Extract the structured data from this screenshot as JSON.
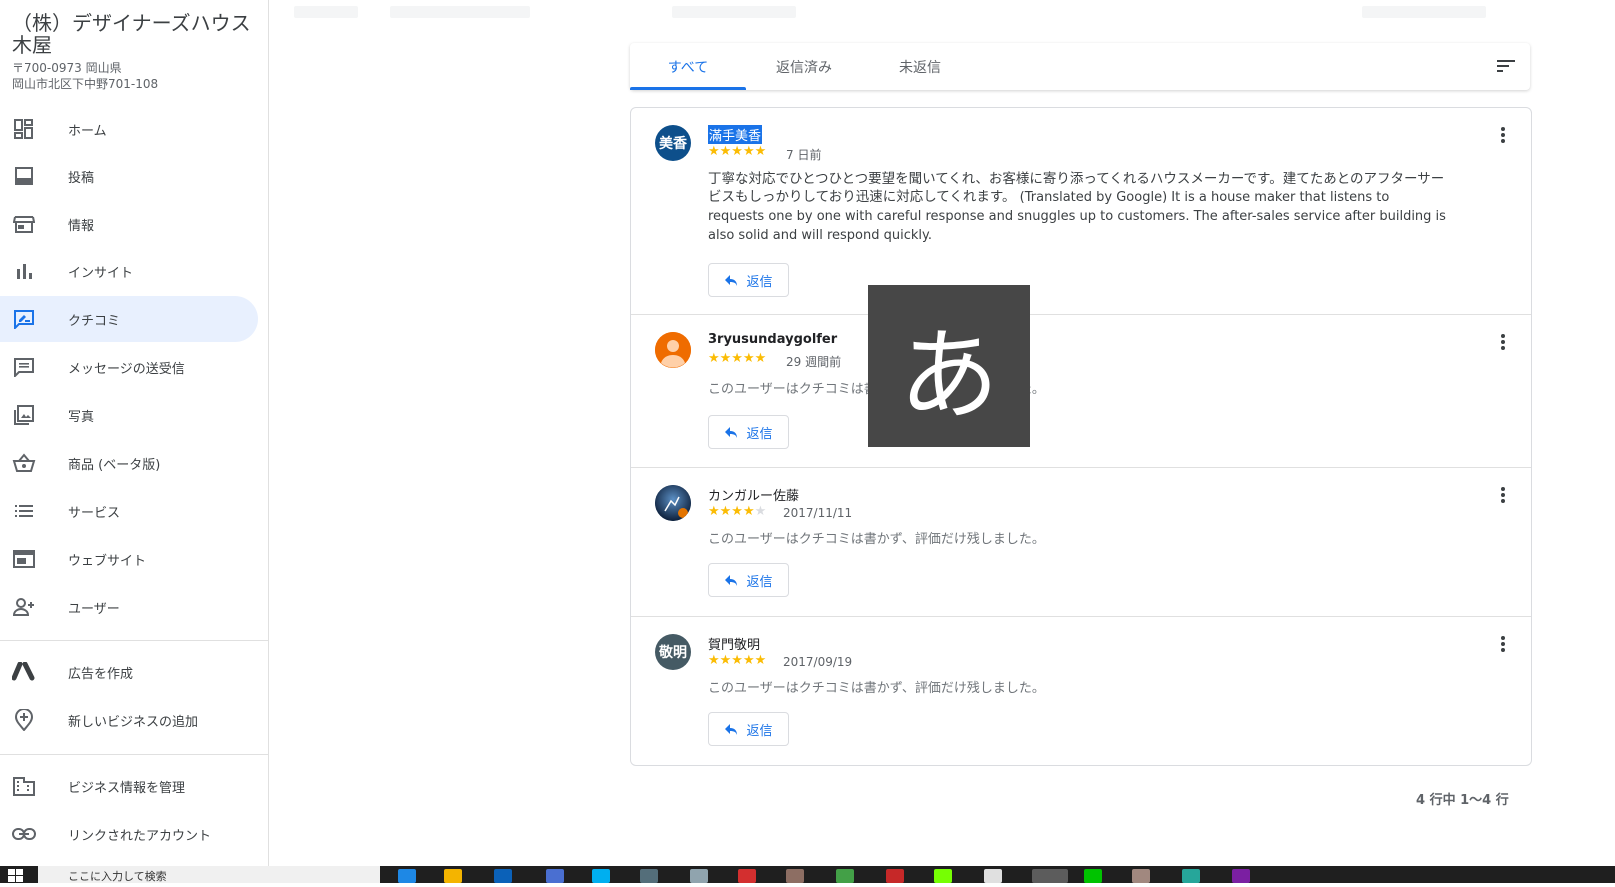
{
  "business": {
    "name": "（株）デザイナーズハウス木屋",
    "address_line1": "〒700-0973 岡山県",
    "address_line2": "岡山市北区下中野701-108"
  },
  "sidebar": {
    "items": [
      {
        "label": "ホーム",
        "icon": "dashboard-icon"
      },
      {
        "label": "投稿",
        "icon": "posts-icon"
      },
      {
        "label": "情報",
        "icon": "storefront-icon"
      },
      {
        "label": "インサイト",
        "icon": "bar-chart-icon"
      },
      {
        "label": "クチコミ",
        "icon": "rate-review-icon",
        "active": true
      },
      {
        "label": "メッセージの送受信",
        "icon": "message-icon"
      },
      {
        "label": "写真",
        "icon": "photo-library-icon"
      },
      {
        "label": "商品 (ベータ版)",
        "icon": "basket-icon"
      },
      {
        "label": "サービス",
        "icon": "list-icon"
      },
      {
        "label": "ウェブサイト",
        "icon": "web-icon"
      },
      {
        "label": "ユーザー",
        "icon": "person-add-icon"
      }
    ],
    "secondary": [
      {
        "label": "広告を作成",
        "icon": "google-ads-icon"
      },
      {
        "label": "新しいビジネスの追加",
        "icon": "add-location-icon"
      }
    ],
    "tertiary": [
      {
        "label": "ビジネス情報を管理",
        "icon": "business-icon"
      },
      {
        "label": "リンクされたアカウント",
        "icon": "link-icon"
      }
    ]
  },
  "tabs": {
    "all": "すべて",
    "replied": "返信済み",
    "unreplied": "未返信"
  },
  "reviews": [
    {
      "avatar": "美香",
      "avatar_color": "#0d4f8b",
      "name": "滿手美香",
      "rating": 5,
      "when": "7 日前",
      "text_jp": "丁寧な対応でひとつひとつ要望を聞いてくれ、お客様に寄り添ってくれるハウスメーカーです。建てたあとのアフターサービスもしっかりしており迅速に対応してくれます。",
      "text_en": "(Translated by Google) It is a house maker that listens to requests one by one with careful response and snuggles up to customers. The after-sales service after building is also solid and will respond quickly.",
      "reply": "返信"
    },
    {
      "avatar": "",
      "avatar_color": "#ef6c00",
      "name": "3ryusundaygolfer",
      "rating": 5,
      "when": "29 週間前",
      "text": "このユーザーはクチコミは書かず、評価だけ残しました。",
      "reply": "返信"
    },
    {
      "avatar": "",
      "avatar_color": "#1b3a5c",
      "name": "カンガルー佐藤",
      "rating": 4,
      "when": "2017/11/11",
      "text": "このユーザーはクチコミは書かず、評価だけ残しました。",
      "reply": "返信"
    },
    {
      "avatar": "敬明",
      "avatar_color": "#455a64",
      "name": "賀門敬明",
      "rating": 5,
      "when": "2017/09/19",
      "text": "このユーザーはクチコミは書かず、評価だけ残しました。",
      "reply": "返信"
    }
  ],
  "pager": "4 行中 1〜4 行",
  "ime_char": "あ",
  "taskbar": {
    "search_placeholder": "ここに入力して検索"
  },
  "colors": {
    "accent": "#1a73e8",
    "active_bg": "#e8f0fe",
    "star": "#fbbc04"
  }
}
